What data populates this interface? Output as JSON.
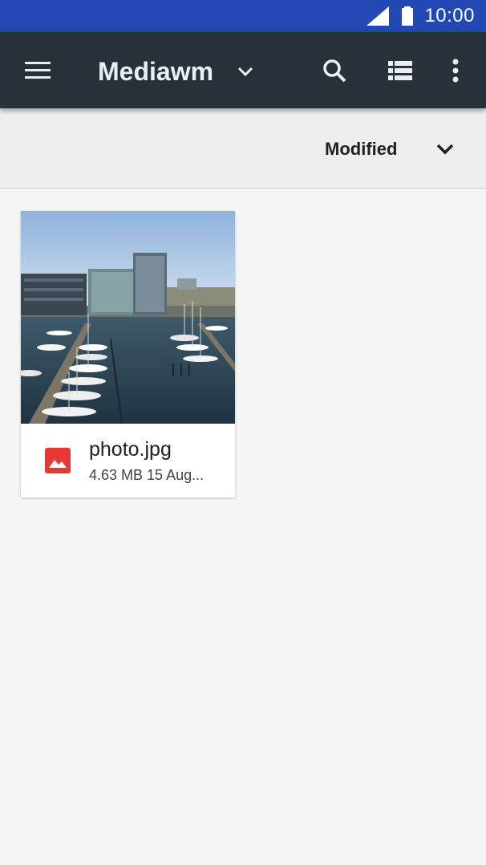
{
  "status_bar": {
    "time": "10:00",
    "icons": [
      "cell-signal-icon",
      "battery-icon"
    ]
  },
  "toolbar": {
    "title": "Mediawm",
    "icons": [
      "menu-icon",
      "chevron-down-icon",
      "search-icon",
      "list-view-icon",
      "more-vert-icon"
    ]
  },
  "sort": {
    "label": "Modified"
  },
  "files": [
    {
      "name": "photo.jpg",
      "meta": "4.63 MB  15 Aug...",
      "type_icon": "image-file-icon",
      "type_color": "#e53935"
    }
  ],
  "colors": {
    "status_bar": "#2148b3",
    "toolbar": "#263238",
    "background": "#f5f5f5"
  }
}
